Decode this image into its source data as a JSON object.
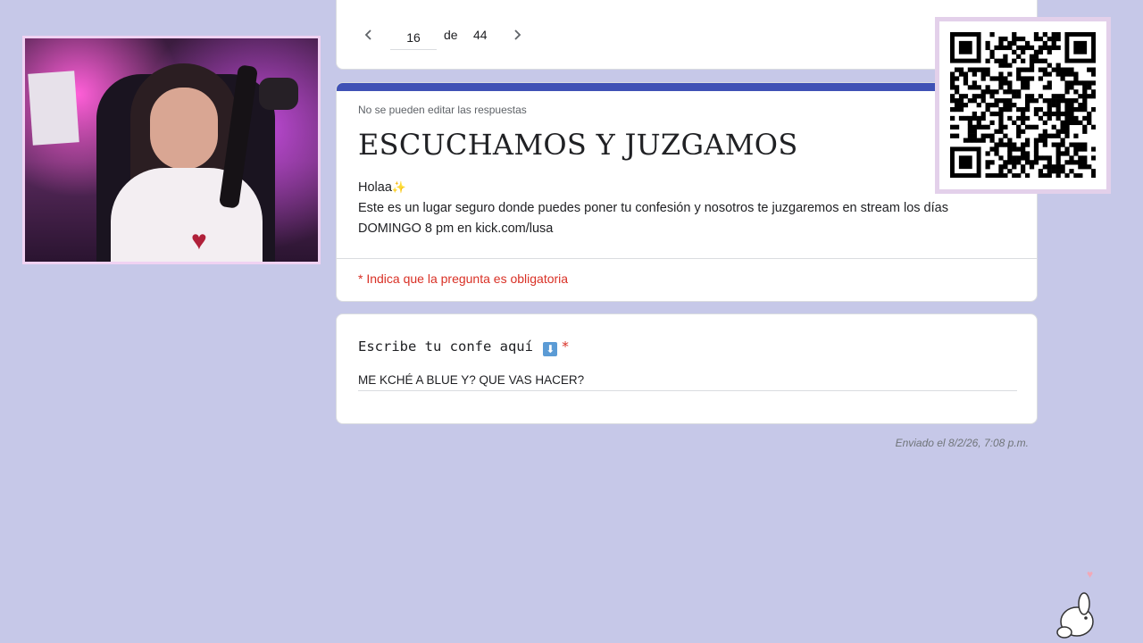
{
  "pager": {
    "current_page": "16",
    "of_label": "de",
    "total_pages": "44",
    "prev_icon": "chevron-left-icon",
    "next_icon": "chevron-right-icon"
  },
  "form": {
    "note": "No se pueden editar las respuestas",
    "title": "ESCUCHAMOS Y JUZGAMOS",
    "greeting": "Holaa",
    "greeting_icon": "sparkle-icon",
    "description": "Este es un lugar seguro donde puedes poner tu confesión y nosotros te juzgaremos en stream los días DOMINGO 8 pm en kick.com/lusa",
    "required_notice": "* Indica que la pregunta es obligatoria",
    "accent_color": "#3f51b5",
    "required_color": "#d93025"
  },
  "question": {
    "label": "Escribe tu confe aquí",
    "label_icon": "down-arrow-icon",
    "required_marker": "*",
    "answer": "ME KCHÉ A BLUE Y? QUE VAS HACER?"
  },
  "submission": {
    "sent_text": "Enviado el 8/2/26, 7:08 p.m."
  },
  "overlay": {
    "webcam": "webcam-feed",
    "qr": "qr-code",
    "mascot": "bunny-icon",
    "background_color": "#c6c8e8"
  }
}
